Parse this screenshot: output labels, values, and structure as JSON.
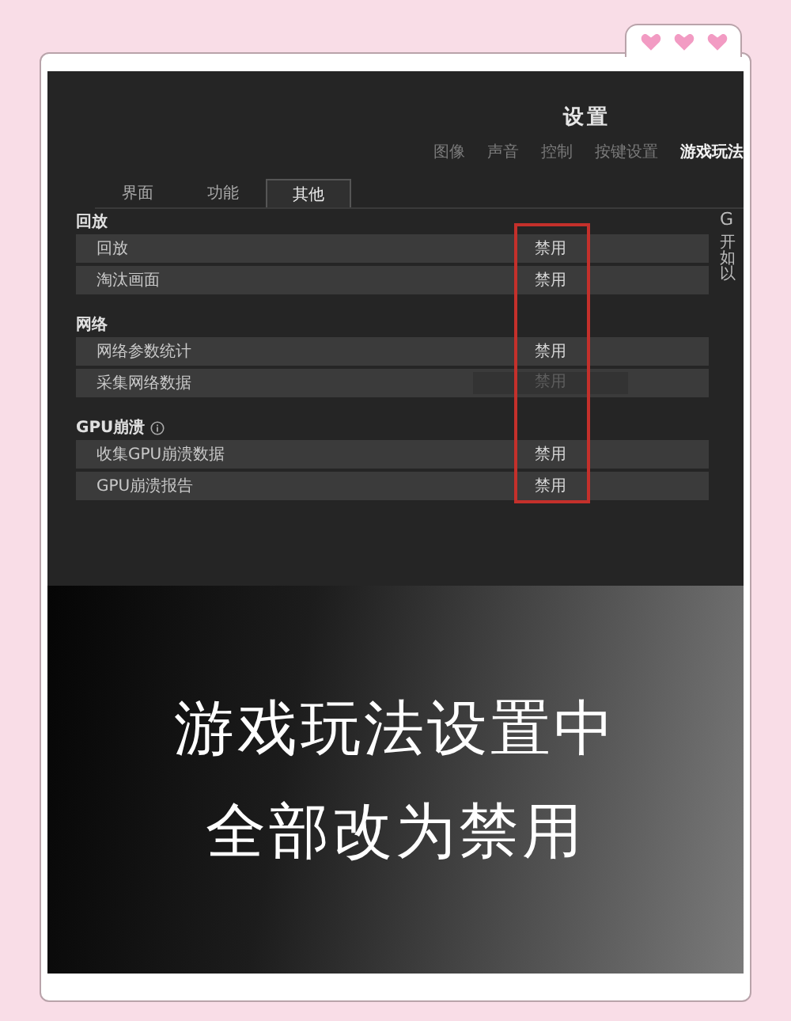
{
  "title": "设置",
  "tabs": [
    {
      "label": "图像",
      "selected": false
    },
    {
      "label": "声音",
      "selected": false
    },
    {
      "label": "控制",
      "selected": false
    },
    {
      "label": "按键设置",
      "selected": false
    },
    {
      "label": "游戏玩法",
      "selected": true
    }
  ],
  "subtabs": [
    {
      "label": "界面",
      "selected": false
    },
    {
      "label": "功能",
      "selected": false
    },
    {
      "label": "其他",
      "selected": true
    }
  ],
  "sections": [
    {
      "title": "回放",
      "info": false,
      "rows": [
        {
          "label": "回放",
          "value": "禁用",
          "disabled": false
        },
        {
          "label": "淘汰画面",
          "value": "禁用",
          "disabled": false
        }
      ]
    },
    {
      "title": "网络",
      "info": false,
      "rows": [
        {
          "label": "网络参数统计",
          "value": "禁用",
          "disabled": false
        },
        {
          "label": "采集网络数据",
          "value": "禁用",
          "disabled": true
        }
      ]
    },
    {
      "title": "GPU崩溃",
      "info": true,
      "rows": [
        {
          "label": "收集GPU崩溃数据",
          "value": "禁用",
          "disabled": false
        },
        {
          "label": "GPU崩溃报告",
          "value": "禁用",
          "disabled": false
        }
      ]
    }
  ],
  "side_panel": {
    "heading": "G",
    "lines": [
      "开",
      "如",
      "以"
    ]
  },
  "caption": [
    "游戏玩法设置中",
    "全部改为禁用"
  ]
}
